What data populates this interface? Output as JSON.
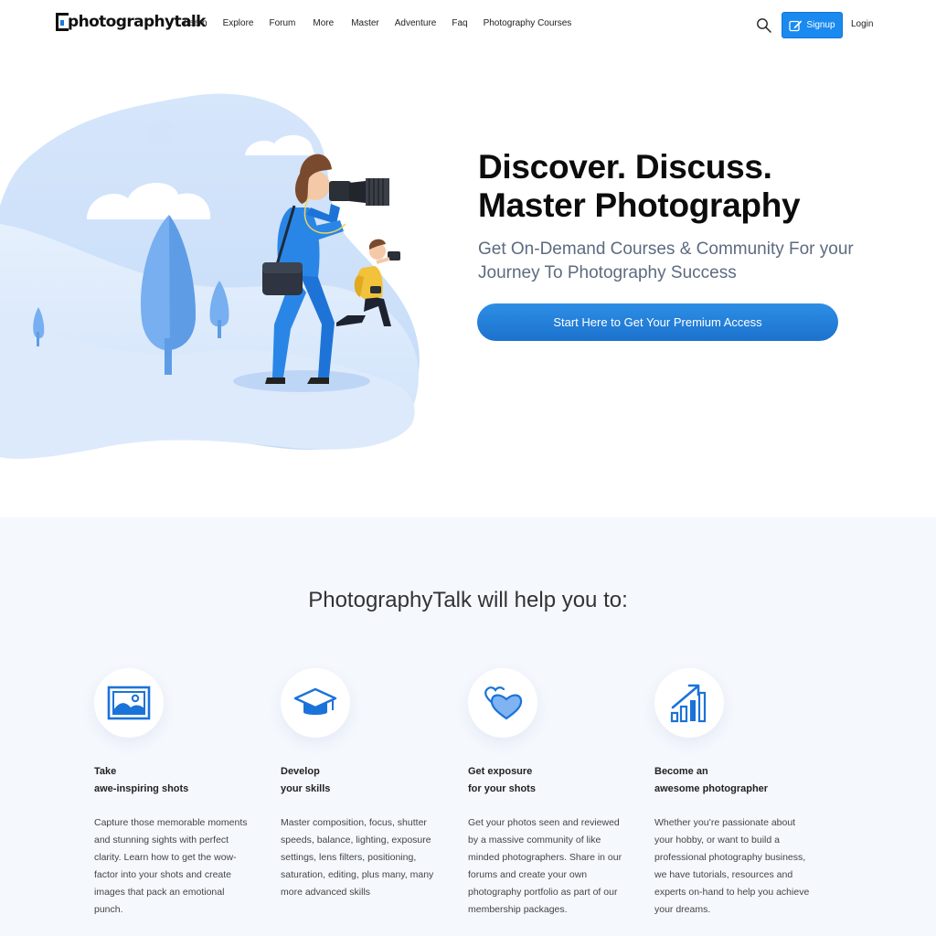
{
  "header": {
    "logo_text": "photographytalk",
    "nav": [
      "Learn",
      "Explore",
      "Forum",
      "More",
      "Master",
      "Adventure",
      "Faq",
      "Photography Courses"
    ],
    "signup_label": "Signup",
    "login_label": "Login",
    "icons": {
      "search": "search-icon",
      "signup": "edit-icon"
    }
  },
  "hero": {
    "title_line1": "Discover. Discuss.",
    "title_line2": "Master Photography",
    "subtitle": "Get On-Demand Courses & Community For your Journey To Photography Success",
    "cta_label": "Start Here to Get Your Premium Access"
  },
  "features": {
    "title": "PhotographyTalk will help you to:",
    "items": [
      {
        "icon": "image-icon",
        "heading_line1": "Take",
        "heading_line2": "awe-inspiring shots",
        "text": "Capture those memorable moments and stunning sights with perfect clarity. Learn how to get the wow-factor into your shots and create images that pack an emotional punch."
      },
      {
        "icon": "graduation-cap-icon",
        "heading_line1": "Develop",
        "heading_line2": "your skills",
        "text": "Master composition, focus, shutter speeds, balance, lighting, exposure settings, lens filters, positioning, saturation, editing, plus many, many more advanced skills"
      },
      {
        "icon": "hearts-icon",
        "heading_line1": "Get exposure",
        "heading_line2": "for your shots",
        "text": "Get your photos seen and reviewed by a massive community of like minded photographers. Share in our forums and create your own photography portfolio as part of our membership packages."
      },
      {
        "icon": "growth-chart-icon",
        "heading_line1": "Become an",
        "heading_line2": "awesome photographer",
        "text": "Whether you’re passionate about your hobby, or want to build a professional photography business, we have tutorials, resources and experts on-hand to help you achieve your dreams."
      }
    ]
  },
  "colors": {
    "accent": "#1a8af0",
    "cta": "#1c72cd",
    "icon_blue": "#1a73d9",
    "section_bg": "#f5f8fd",
    "subtitle": "#5d6b80"
  }
}
